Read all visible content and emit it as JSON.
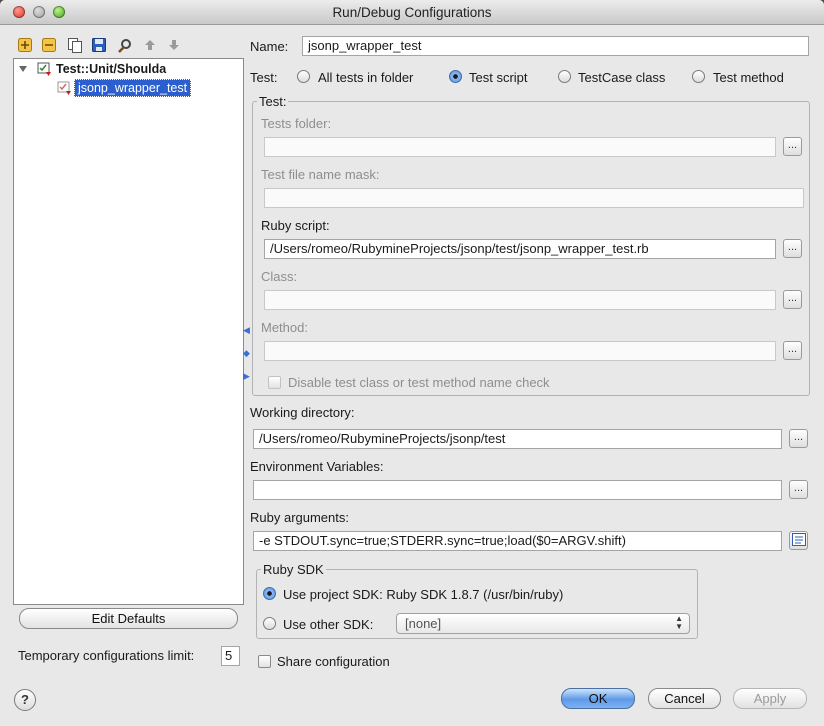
{
  "window": {
    "title": "Run/Debug Configurations"
  },
  "toolbar": {
    "icons": [
      "add-icon",
      "remove-icon",
      "copy-icon",
      "save-icon",
      "edit-defaults-icon",
      "move-up-icon",
      "move-down-icon"
    ]
  },
  "tree": {
    "root_label": "Test::Unit/Shoulda",
    "child_label": "jsonp_wrapper_test"
  },
  "left": {
    "edit_defaults_label": "Edit Defaults",
    "temp_limit_label": "Temporary configurations limit:",
    "temp_limit_value": "5"
  },
  "form": {
    "name_label": "Name:",
    "name_value": "jsonp_wrapper_test",
    "test_label": "Test:",
    "test_options": [
      "All tests in folder",
      "Test script",
      "TestCase class",
      "Test method"
    ],
    "selected_option": "Test script",
    "test_group_title": "Test:",
    "tests_folder_label": "Tests folder:",
    "tests_folder_value": "",
    "mask_label": "Test file name mask:",
    "mask_value": "",
    "ruby_script_label": "Ruby script:",
    "ruby_script_value": "/Users/romeo/RubymineProjects/jsonp/test/jsonp_wrapper_test.rb",
    "class_label": "Class:",
    "class_value": "",
    "method_label": "Method:",
    "method_value": "",
    "disable_check_label": "Disable test class or test method name check",
    "working_dir_label": "Working directory:",
    "working_dir_value": "/Users/romeo/RubymineProjects/jsonp/test",
    "env_label": "Environment Variables:",
    "env_value": "",
    "ruby_args_label": "Ruby arguments:",
    "ruby_args_value": "-e STDOUT.sync=true;STDERR.sync=true;load($0=ARGV.shift)",
    "sdk_group_title": "Ruby SDK",
    "use_project_sdk_label": "Use project SDK: Ruby SDK 1.8.7 (/usr/bin/ruby)",
    "use_other_sdk_label": "Use other SDK:",
    "other_sdk_value": "[none]",
    "share_label": "Share configuration",
    "browse_label": "..."
  },
  "buttons": {
    "help": "?",
    "ok": "OK",
    "cancel": "Cancel",
    "apply": "Apply"
  },
  "colors": {
    "selection": "#2b5fd0",
    "primary_button": "#5e9ae8"
  }
}
